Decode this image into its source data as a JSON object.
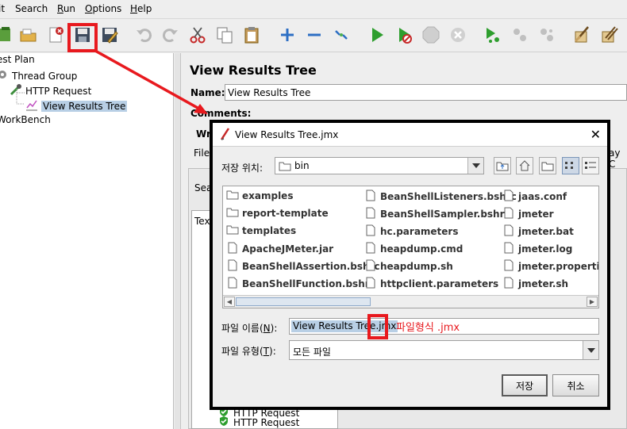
{
  "menubar": {
    "items": [
      {
        "label": "it",
        "mnemonic": ""
      },
      {
        "label": "Search",
        "mnemonic": ""
      },
      {
        "label": "Run",
        "mnemonic": "R"
      },
      {
        "label": "Options",
        "mnemonic": "O"
      },
      {
        "label": "Help",
        "mnemonic": "H"
      }
    ]
  },
  "toolbar": {
    "icons": [
      "templates-icon",
      "open-icon",
      "close-icon",
      "save-icon",
      "save-as-icon",
      "undo-icon",
      "redo-icon",
      "cut-icon",
      "copy-icon",
      "paste-icon",
      "expand-icon",
      "collapse-icon",
      "toggle-icon",
      "start-icon",
      "start-no-pause-icon",
      "stop-icon",
      "shutdown-icon",
      "remote-start-icon",
      "remote-stop-icon",
      "remote-exit-icon",
      "clear-icon",
      "clear-all-icon"
    ]
  },
  "tree": {
    "nodes": [
      {
        "label": "est Plan",
        "icon": "test-plan-icon"
      },
      {
        "label": "Thread Group",
        "icon": "gear-icon"
      },
      {
        "label": "HTTP Request",
        "icon": "pipette-icon"
      },
      {
        "label": "View Results Tree",
        "icon": "graph-icon",
        "selected": true
      },
      {
        "label": "WorkBench",
        "icon": "workbench-icon"
      }
    ]
  },
  "panel": {
    "title": "View Results Tree",
    "name_label": "Name:",
    "name_value": "View Results Tree",
    "comments_label": "Comments:",
    "frag_wr": "Wr",
    "frag_file": "File",
    "frag_sea": "Sea",
    "frag_tex": "Tex",
    "frag_day": "ay C",
    "result_items": [
      {
        "label": "HTTP Request",
        "status": "success"
      },
      {
        "label": "HTTP Request",
        "status": "success"
      }
    ]
  },
  "dialog": {
    "title": "View Results Tree.jmx",
    "location_label": "저장 위치:",
    "location_value": "bin",
    "files": [
      {
        "name": "examples",
        "type": "folder"
      },
      {
        "name": "report-template",
        "type": "folder"
      },
      {
        "name": "templates",
        "type": "folder"
      },
      {
        "name": "ApacheJMeter.jar",
        "type": "file"
      },
      {
        "name": "BeanShellAssertion.bshrc",
        "type": "file"
      },
      {
        "name": "BeanShellFunction.bshrc",
        "type": "file"
      },
      {
        "name": "BeanShellListeners.bshrc",
        "type": "file"
      },
      {
        "name": "BeanShellSampler.bshrc",
        "type": "file"
      },
      {
        "name": "hc.parameters",
        "type": "file"
      },
      {
        "name": "heapdump.cmd",
        "type": "file"
      },
      {
        "name": "heapdump.sh",
        "type": "file"
      },
      {
        "name": "httpclient.parameters",
        "type": "file"
      },
      {
        "name": "jaas.conf",
        "type": "file"
      },
      {
        "name": "jmeter",
        "type": "file"
      },
      {
        "name": "jmeter.bat",
        "type": "file"
      },
      {
        "name": "jmeter.log",
        "type": "file"
      },
      {
        "name": "jmeter.properties",
        "type": "file"
      },
      {
        "name": "jmeter.sh",
        "type": "file"
      }
    ],
    "filename_label": "파일 이름(N):",
    "filename_label_pre": "파일 이름(",
    "filename_label_key": "N",
    "filename_label_post": "):",
    "filename_value": "View Results Tree.jmx",
    "filetype_label_pre": "파일 유형(",
    "filetype_label_key": "T",
    "filetype_label_post": "):",
    "filetype_value": "모든 파일",
    "save_button": "저장",
    "cancel_button": "취소"
  },
  "annotation": {
    "text": "파일형식 .jmx",
    "color": "#e8191e"
  }
}
